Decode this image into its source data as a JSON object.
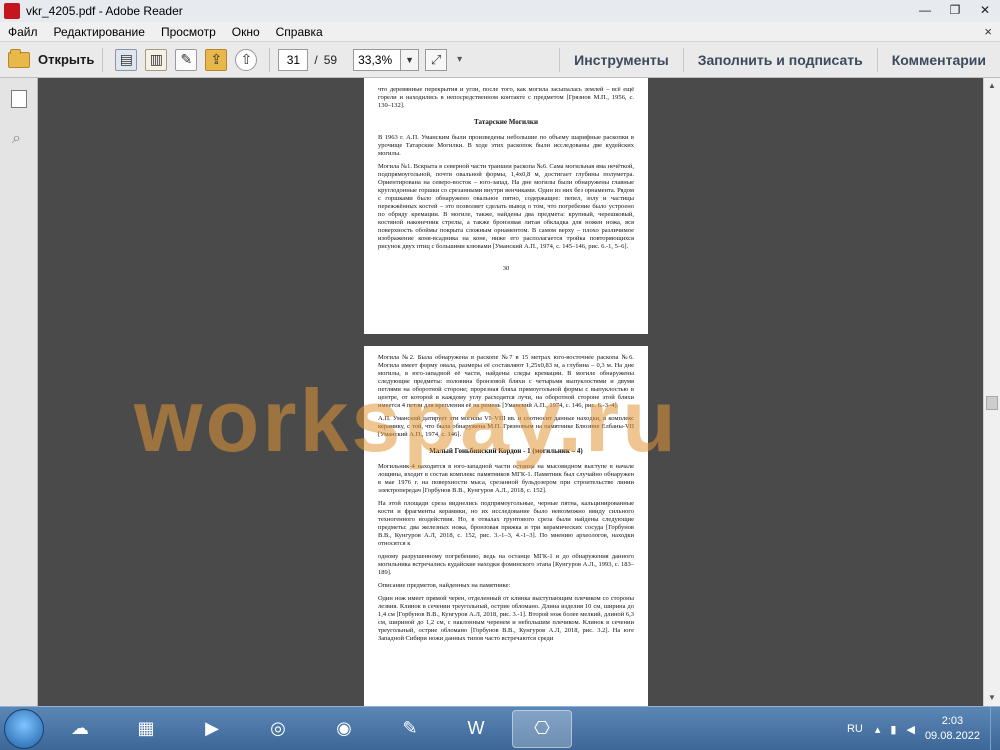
{
  "window": {
    "title": "vkr_4205.pdf - Adobe Reader",
    "minimize": "—",
    "maximize": "❐",
    "close": "✕"
  },
  "menu": {
    "items": [
      "Файл",
      "Редактирование",
      "Просмотр",
      "Окно",
      "Справка"
    ],
    "close": "×"
  },
  "toolbar": {
    "open_label": "Открыть",
    "page_current": "31",
    "page_separator": "/",
    "page_total": "59",
    "zoom": "33,3%",
    "tools": "Инструменты",
    "fill_sign": "Заполнить и подписать",
    "comments": "Комментарии"
  },
  "document": {
    "page1": {
      "top_text": "что деревянные перекрытия и угли, после того, как могила засыпалась землей – всё ещё горели и находились в непосредственном контакте с предметом [Грязнов М.П., 1956, с. 130–132].",
      "heading": "Татарские Могилки",
      "p1": "В 1963 г. А.П. Уманским были произведены небольшие по объему шарифные раскопки в урочище Татарские Могилки. В ходе этих раскопок были исследованы две кудейских могилы.",
      "p2": "Могила №1. Вскрыта в северной части траншеи раскопа №6. Сама могильная яма нечёткой, подпрямоугольной, почти овальной формы, 1,4х0,8 м, достигает глубины полуметра. Ориентирована на северо-восток – юго-запад. На дне могилы были обнаружены главные круглодонные горшки со срезанными внутри венчиками. Один из них без орнамента. Рядом с горшками было обнаружено овальное пятно, содержащее: пепел, золу и частицы пережжённых костей – это позволяет сделать вывод о том, что погребение было устроено по обряду кремации. В могиле, также, найдены два предмета: крупный, черешковый, костяной наконечник стрелы, а также бронзовая литая обкладка для ножен ножа, вся поверхность обоймы покрыта сложным орнаментом. В самом верху – плохо различимое изображение коня-всадника на коне, ниже его располагается тройка повторяющихся рисунок двух птиц с большими клювами [Уманский А.П., 1974, с. 145–146, рис. 6.-1, 5–6].",
      "page_number": "30"
    },
    "page2": {
      "p1": "Могила №2. Была обнаружена в раскопе №7 в 15 метрах юго-восточнее раскопа №6. Могила имеет форму овала, размеры её составляют 1,25х0,83 м, а глубина – 0,3 м. На дне могилы, в юго-западной её части, найдены следы кремации. В могиле обнаружены следующие предметы: половина бронзовой бляхи с четырьмя выпуклостями и двумя петлями на оборотной стороне; прорезная бляха прямоугольной формы с выпуклостью в центре, от которой в каждому углу расходятся лучи, на оборотной стороне этой бляхи имеется 4 петли для крепления её на ремень [Уманский А.П., 1974, с. 146, рис. 6.-3–4].",
      "p2": "А.П. Уманский датирует эти могилы VI–VIII вв. и соотносит данные находки, в комплекс керамику, с той, что была обнаружена М.П. Грязновым на памятнике Блюзние Елбаны-VII [Уманский А.П., 1974, с. 146].",
      "heading": "Малый Гоньбинский Кордон - 1 (могильник – 4)",
      "p3": "Могильник-4 находится в юго-западной части останца на мысовидном выступе в начале лощины, входит в состав комплекс памятников МГК-1. Памятник был случайно обнаружен в мае 1976 г. на поверхности мыса, срезанной бульдозером при строительстве линии электропередач [Горбунов В.В., Кунгуров А.Л., 2018, с. 152].",
      "p4": "На этой площади среза виднелись подпрямоугольные, черные пятна, кальцинированные кости и фрагменты керамики, но их исследование было невозможно ввиду сильного техногенного воздействия. Но, в отвалах грунтового среза были найдены следующие предметы: два железных ножа, бронзовая пряжка и три керамических сосуда [Горбунов В.В., Кунгуров А.Л, 2018, с. 152, рис. 3.-1–3, 4.-1–3]. По мнению археологов, находки относятся к",
      "p5": "одному разрушенному погребению, ведь на останце МГК-1 и до обнаружения данного могильника встречались кудайские находки фоминского этапа [Кунгуров А.Л., 1993, с. 183–189].",
      "p6": "Описание предметов, найденных на памятнике:",
      "p7": "Один нож имеет прямой черен, отделенный от клинка выступающим плечиком со стороны лезвия. Клинок в сечении треугольный, острие обломано. Длина изделия 10 см, ширина до 1,4 см [Горбунов В.В., Кунгуров А.Л, 2018, рис. 3.-1]. Второй нож более мелкий, длиной 6,3 см, шириной до 1,2 см, с наклонным черенем и небольшим плечиком. Клинок в сечении треугольный, острие обломано [Горбунов В.В., Кунгуров А.Л, 2018, рис. 3.2]. На юге Западной Сибири ножи данных типов часто встречаются среди"
    },
    "watermark": "workspay.ru"
  },
  "taskbar": {
    "language": "RU",
    "time": "2:03",
    "date": "09.08.2022"
  }
}
